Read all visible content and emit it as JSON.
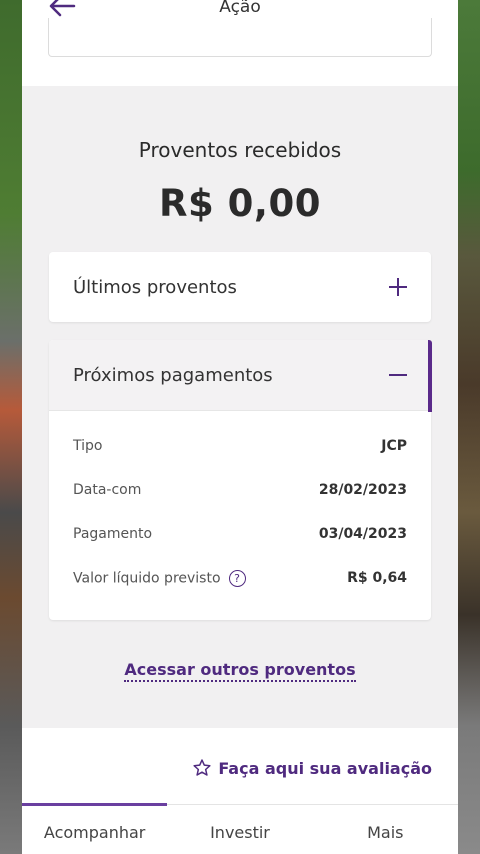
{
  "header": {
    "title": "Ação"
  },
  "section": {
    "title": "Proventos recebidos",
    "amount": "R$ 0,00"
  },
  "accordions": [
    {
      "label": "Últimos proventos",
      "icon": "plus-icon"
    },
    {
      "label": "Próximos pagamentos",
      "icon": "minus-icon"
    }
  ],
  "details": [
    {
      "label": "Tipo",
      "value": "JCP"
    },
    {
      "label": "Data-com",
      "value": "28/02/2023"
    },
    {
      "label": "Pagamento",
      "value": "03/04/2023"
    },
    {
      "label": "Valor líquido previsto",
      "value": "R$ 0,64"
    }
  ],
  "help_icon_char": "?",
  "link": {
    "label": "Acessar outros proventos"
  },
  "rating": {
    "label": "Faça aqui sua avaliação",
    "icon": "star-icon"
  },
  "nav": [
    {
      "label": "Acompanhar",
      "active": true
    },
    {
      "label": "Investir"
    },
    {
      "label": "Mais"
    }
  ],
  "colors": {
    "accent": "#4f2a7f",
    "section_bg": "#f1f0f1"
  }
}
